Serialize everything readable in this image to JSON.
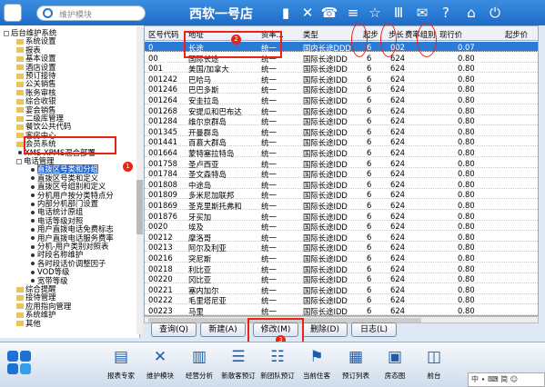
{
  "header": {
    "title": "西软一号店",
    "search_placeholder": "维护模块"
  },
  "tree": [
    {
      "label": "后台维护系统",
      "lvl": 0,
      "kind": "pm"
    },
    {
      "label": "系统设置",
      "lvl": 1,
      "kind": "fd"
    },
    {
      "label": "报表",
      "lvl": 1,
      "kind": "fd"
    },
    {
      "label": "基本设置",
      "lvl": 1,
      "kind": "fd"
    },
    {
      "label": "酒店设置",
      "lvl": 1,
      "kind": "fd"
    },
    {
      "label": "预订接待",
      "lvl": 1,
      "kind": "fd"
    },
    {
      "label": "公关销售",
      "lvl": 1,
      "kind": "fd"
    },
    {
      "label": "账务审核",
      "lvl": 1,
      "kind": "fd"
    },
    {
      "label": "综合收银",
      "lvl": 1,
      "kind": "fd"
    },
    {
      "label": "宴会销售",
      "lvl": 1,
      "kind": "fd"
    },
    {
      "label": "二级库管理",
      "lvl": 1,
      "kind": "fd"
    },
    {
      "label": "餐饮公共代码",
      "lvl": 1,
      "kind": "fd"
    },
    {
      "label": "客房中心",
      "lvl": 1,
      "kind": "fd"
    },
    {
      "label": "会员系统",
      "lvl": 1,
      "kind": "fd"
    },
    {
      "label": "XMS-XPMS混合部署",
      "lvl": 1,
      "kind": "dot"
    },
    {
      "label": "电话管理",
      "lvl": 1,
      "kind": "pm"
    },
    {
      "label": "直拨区号类和分组",
      "lvl": 2,
      "kind": "dot",
      "sel": true
    },
    {
      "label": "直拨区号类和定义",
      "lvl": 2,
      "kind": "dot"
    },
    {
      "label": "直拨区号组别和定义",
      "lvl": 2,
      "kind": "dot"
    },
    {
      "label": "分机用户按分类特点分",
      "lvl": 2,
      "kind": "dot"
    },
    {
      "label": "内部分机部门设置",
      "lvl": 2,
      "kind": "dot"
    },
    {
      "label": "电话统计原组",
      "lvl": 2,
      "kind": "dot"
    },
    {
      "label": "电话等级对照",
      "lvl": 2,
      "kind": "dot"
    },
    {
      "label": "用户直拨电话免费标志",
      "lvl": 2,
      "kind": "dot"
    },
    {
      "label": "用户直拨电话服务费率",
      "lvl": 2,
      "kind": "dot"
    },
    {
      "label": "分机-用户类别对照表",
      "lvl": 2,
      "kind": "dot"
    },
    {
      "label": "时段名称维护",
      "lvl": 2,
      "kind": "dot"
    },
    {
      "label": "各时段话价调整因子",
      "lvl": 2,
      "kind": "dot"
    },
    {
      "label": "VOD等级",
      "lvl": 2,
      "kind": "dot"
    },
    {
      "label": "宽带等级",
      "lvl": 2,
      "kind": "dot"
    },
    {
      "label": "综合提醒",
      "lvl": 1,
      "kind": "fd"
    },
    {
      "label": "接待管理",
      "lvl": 1,
      "kind": "fd"
    },
    {
      "label": "应用指向管理",
      "lvl": 1,
      "kind": "fd"
    },
    {
      "label": "系统维护",
      "lvl": 1,
      "kind": "fd"
    },
    {
      "label": "其他",
      "lvl": 1,
      "kind": "fd"
    }
  ],
  "grid": {
    "headers": [
      "区号代码",
      "地址",
      "资率...",
      "类型",
      "起步",
      "步长",
      "费率组别",
      "现行价",
      "起步价"
    ],
    "rows": [
      [
        "0",
        "长途",
        "统一",
        "国内长途DDD",
        "6",
        "002",
        "",
        "0.07",
        ""
      ],
      [
        "00",
        "国际长途",
        "统一",
        "国际长途IDD",
        "6",
        "624",
        "",
        "0.80",
        ""
      ],
      [
        "001",
        "美国/加拿大",
        "统一",
        "国际长途IDD",
        "6",
        "624",
        "",
        "0.80",
        ""
      ],
      [
        "001242",
        "巴哈马",
        "统一",
        "国际长途IDD",
        "6",
        "624",
        "",
        "0.80",
        ""
      ],
      [
        "001246",
        "巴巴多斯",
        "统一",
        "国际长途IDD",
        "6",
        "624",
        "",
        "0.80",
        ""
      ],
      [
        "001264",
        "安圭拉岛",
        "统一",
        "国际长途IDD",
        "6",
        "624",
        "",
        "0.80",
        ""
      ],
      [
        "001268",
        "安提瓜和巴布达",
        "统一",
        "国际长途IDD",
        "6",
        "624",
        "",
        "0.80",
        ""
      ],
      [
        "001284",
        "维尔京群岛",
        "统一",
        "国际长途IDD",
        "6",
        "624",
        "",
        "0.80",
        ""
      ],
      [
        "001345",
        "开曼群岛",
        "统一",
        "国际长途IDD",
        "6",
        "624",
        "",
        "0.80",
        ""
      ],
      [
        "001441",
        "百慕大群岛",
        "统一",
        "国际长途IDD",
        "6",
        "624",
        "",
        "0.80",
        ""
      ],
      [
        "001664",
        "蒙特塞拉特岛",
        "统一",
        "国际长途IDD",
        "6",
        "624",
        "",
        "0.80",
        ""
      ],
      [
        "001758",
        "圣卢西亚",
        "统一",
        "国际长途IDD",
        "6",
        "624",
        "",
        "0.80",
        ""
      ],
      [
        "001784",
        "圣文森特岛",
        "统一",
        "国际长途IDD",
        "6",
        "624",
        "",
        "0.80",
        ""
      ],
      [
        "001808",
        "中途岛",
        "统一",
        "国际长途IDD",
        "6",
        "624",
        "",
        "0.80",
        ""
      ],
      [
        "001809",
        "多米尼加联邦",
        "统一",
        "国际长途IDD",
        "6",
        "624",
        "",
        "0.80",
        ""
      ],
      [
        "001869",
        "圣克里斯托弗和",
        "统一",
        "国际长途IDD",
        "6",
        "624",
        "",
        "0.80",
        ""
      ],
      [
        "001876",
        "牙买加",
        "统一",
        "国际长途IDD",
        "6",
        "624",
        "",
        "0.80",
        ""
      ],
      [
        "0020",
        "埃及",
        "统一",
        "国际长途IDD",
        "6",
        "624",
        "",
        "0.80",
        ""
      ],
      [
        "00212",
        "摩洛哥",
        "统一",
        "国际长途IDD",
        "6",
        "624",
        "",
        "0.80",
        ""
      ],
      [
        "00213",
        "阿尔及利亚",
        "统一",
        "国际长途IDD",
        "6",
        "624",
        "",
        "0.80",
        ""
      ],
      [
        "00216",
        "突尼斯",
        "统一",
        "国际长途IDD",
        "6",
        "624",
        "",
        "0.80",
        ""
      ],
      [
        "00218",
        "利比亚",
        "统一",
        "国际长途IDD",
        "6",
        "624",
        "",
        "0.80",
        ""
      ],
      [
        "00220",
        "冈比亚",
        "统一",
        "国际长途IDD",
        "6",
        "624",
        "",
        "0.80",
        ""
      ],
      [
        "00221",
        "塞内加尔",
        "统一",
        "国际长途IDD",
        "6",
        "624",
        "",
        "0.80",
        ""
      ],
      [
        "00222",
        "毛里塔尼亚",
        "统一",
        "国际长途IDD",
        "6",
        "624",
        "",
        "0.80",
        ""
      ],
      [
        "00223",
        "马里",
        "统一",
        "国际长途IDD",
        "6",
        "624",
        "",
        "0.80",
        ""
      ]
    ]
  },
  "buttons": {
    "query": "查询(Q)",
    "add": "新建(A)",
    "edit": "修改(M)",
    "delete": "删除(D)",
    "log": "日志(L)"
  },
  "badges": {
    "b1": "1",
    "b2": "2",
    "b3": "3"
  },
  "bottom": [
    {
      "label": "报表专家",
      "icon": "chart-icon"
    },
    {
      "label": "维护模块",
      "icon": "tools-icon"
    },
    {
      "label": "经营分析",
      "icon": "analysis-icon"
    },
    {
      "label": "新散客预订",
      "icon": "booking-icon"
    },
    {
      "label": "新团队预订",
      "icon": "group-icon"
    },
    {
      "label": "当前住客",
      "icon": "guest-icon"
    },
    {
      "label": "预订列表",
      "icon": "list-icon"
    },
    {
      "label": "房态图",
      "icon": "room-icon"
    },
    {
      "label": "前台",
      "icon": "desk-icon"
    }
  ],
  "ime": "中 ∙ ⌨ 简 ☺"
}
